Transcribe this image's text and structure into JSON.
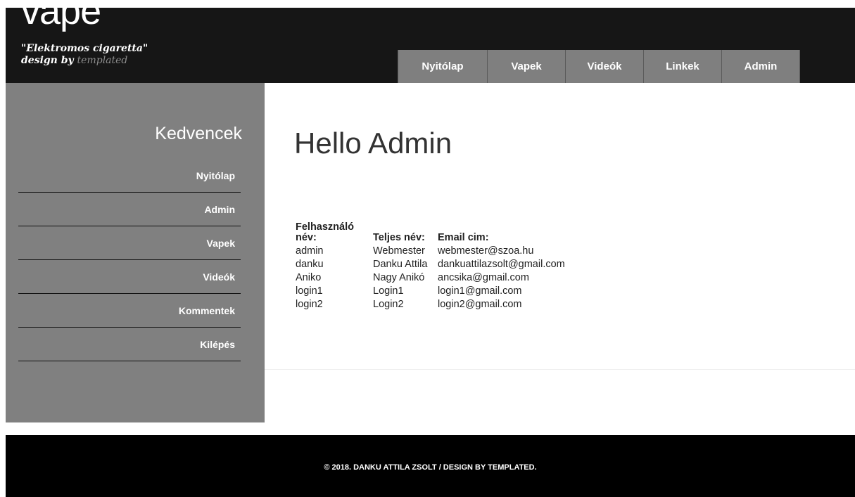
{
  "header": {
    "logo": "vape",
    "tagline": "\"Elektromos cigaretta\"",
    "design_by": "design by",
    "designer": "templated"
  },
  "nav": {
    "items": [
      {
        "label": "Nyitólap"
      },
      {
        "label": "Vapek"
      },
      {
        "label": "Videók"
      },
      {
        "label": "Linkek"
      },
      {
        "label": "Admin"
      }
    ]
  },
  "sidebar": {
    "title": "Kedvencek",
    "items": [
      {
        "label": "Nyitólap"
      },
      {
        "label": "Admin"
      },
      {
        "label": "Vapek"
      },
      {
        "label": "Videók"
      },
      {
        "label": "Kommentek"
      },
      {
        "label": "Kilépés"
      }
    ]
  },
  "main": {
    "heading": "Hello Admin",
    "table": {
      "headers": {
        "username_line1": "Felhasználó",
        "username_line2": "név:",
        "fullname": "Teljes név:",
        "email": "Email cim:"
      },
      "rows": [
        {
          "username": "admin",
          "fullname": "Webmester",
          "email": "webmester@szoa.hu"
        },
        {
          "username": "danku",
          "fullname": "Danku Attila",
          "email": "dankuattilazsolt@gmail.com"
        },
        {
          "username": "Aniko",
          "fullname": "Nagy Anikó",
          "email": "ancsika@gmail.com"
        },
        {
          "username": "login1",
          "fullname": "Login1",
          "email": "login1@gmail.com"
        },
        {
          "username": "login2",
          "fullname": "Login2",
          "email": "login2@gmail.com"
        }
      ]
    }
  },
  "footer": {
    "text": "© 2018. DANKU ATTILA ZSOLT / DESIGN BY TEMPLATED."
  }
}
